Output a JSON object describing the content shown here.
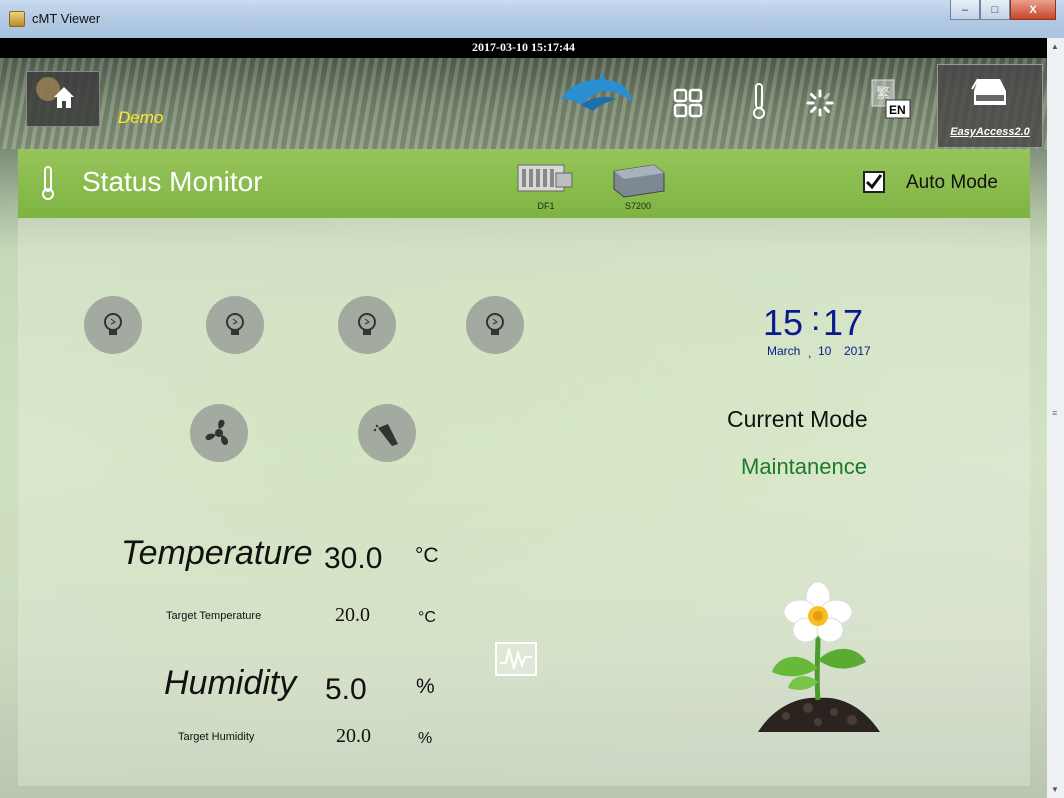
{
  "window": {
    "title": "cMT Viewer",
    "minimize": "–",
    "maximize": "□",
    "close": "X"
  },
  "status_bar": {
    "datetime": "2017-03-10 15:17:44"
  },
  "nav": {
    "demo_label": "Demo",
    "lang_label": "EN",
    "lang_cjk": "繁",
    "easyaccess_label": "EasyAccess2.0"
  },
  "header": {
    "title": "Status Monitor",
    "devices": [
      {
        "label": "DF1"
      },
      {
        "label": "S7200"
      }
    ],
    "auto_mode_label": "Auto Mode",
    "auto_mode_checked": true,
    "check_glyph": "✔"
  },
  "clock": {
    "hour": "15",
    "colon": ":",
    "minute": "17",
    "month": "March",
    "sep": ",",
    "day": "10",
    "year": "2017"
  },
  "mode": {
    "label": "Current Mode",
    "value": "Maintanence"
  },
  "readings": {
    "temperature": {
      "label": "Temperature",
      "value": "30.0",
      "unit": "°C"
    },
    "target_temperature": {
      "label": "Target Temperature",
      "value": "20.0",
      "unit": "°C"
    },
    "humidity": {
      "label": "Humidity",
      "value": "5.0",
      "unit": "%"
    },
    "target_humidity": {
      "label": "Target Humidity",
      "value": "20.0",
      "unit": "%"
    }
  },
  "colors": {
    "green_header": "#86b94a",
    "clock_blue": "#0a1a8c",
    "mode_green": "#1d7a2a",
    "demo_yellow": "#ffea2e"
  },
  "icons": [
    "home-icon",
    "dolphin-logo",
    "apps-grid-icon",
    "thermometer-icon",
    "loading-icon",
    "language-icon",
    "easyaccess-icon",
    "bulb-icon",
    "fan-icon",
    "sprayer-icon",
    "trend-icon",
    "flower-icon"
  ]
}
